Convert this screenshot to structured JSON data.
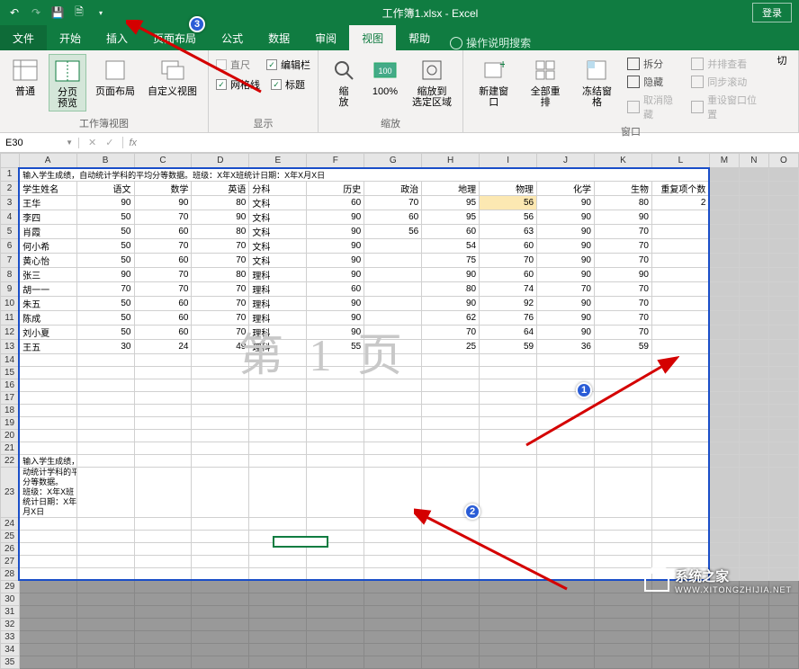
{
  "title": "工作簿1.xlsx - Excel",
  "login": "登录",
  "tabs": {
    "file": "文件",
    "home": "开始",
    "insert": "插入",
    "layout": "页面布局",
    "formula": "公式",
    "data": "数据",
    "review": "审阅",
    "view": "视图",
    "help": "帮助",
    "tellme": "操作说明搜索"
  },
  "ribbon": {
    "views": {
      "normal": "普通",
      "pagebreak": "分页\n预览",
      "pagelayout": "页面布局",
      "custom": "自定义视图",
      "group": "工作簿视图"
    },
    "show": {
      "ruler": "直尺",
      "formulabar": "编辑栏",
      "gridlines": "网格线",
      "headings": "标题",
      "group": "显示"
    },
    "zoom": {
      "zoom": "缩\n放",
      "p100": "100%",
      "fit": "缩放到\n选定区域",
      "group": "缩放"
    },
    "window": {
      "neww": "新建窗口",
      "arrange": "全部重排",
      "freeze": "冻结窗格",
      "split": "拆分",
      "hide": "隐藏",
      "unhide": "取消隐藏",
      "side": "并排查看",
      "sync": "同步滚动",
      "reset": "重设窗口位置",
      "switch": "切",
      "group": "窗口"
    }
  },
  "namebox": "E30",
  "watermark": "第 1 页",
  "cols": [
    "A",
    "B",
    "C",
    "D",
    "E",
    "F",
    "G",
    "H",
    "I",
    "J",
    "K",
    "L",
    "M",
    "N",
    "O"
  ],
  "row1": "输入学生成绩，自动统计学科的平均分等数据。班级：X年X班统计日期：X年X月X日",
  "hdr": {
    "name": "学生姓名",
    "yw": "语文",
    "sx": "数学",
    "yy": "英语",
    "fk": "分科",
    "ls": "历史",
    "zz": "政治",
    "dl": "地理",
    "wl": "物理",
    "hx": "化学",
    "sw": "生物",
    "cf": "重复项个数"
  },
  "students": [
    {
      "n": "王华",
      "yw": 90,
      "sx": 90,
      "yy": 80,
      "fk": "文科",
      "ls": 60,
      "zz": 70,
      "dl": 95,
      "wl": 56,
      "hx": 90,
      "sw": 80,
      "cf": 2
    },
    {
      "n": "李四",
      "yw": 50,
      "sx": 70,
      "yy": 90,
      "fk": "文科",
      "ls": 90,
      "zz": 60,
      "dl": 95,
      "wl": 56,
      "hx": 90,
      "sw": 90,
      "cf": ""
    },
    {
      "n": "肖霞",
      "yw": 50,
      "sx": 60,
      "yy": 80,
      "fk": "文科",
      "ls": 90,
      "zz": 56,
      "dl": 60,
      "wl": 63,
      "hx": 90,
      "sw": 70,
      "cf": ""
    },
    {
      "n": "何小希",
      "yw": 50,
      "sx": 70,
      "yy": 70,
      "fk": "文科",
      "ls": 90,
      "zz": "",
      "dl": 54,
      "wl": 60,
      "hx": 90,
      "sw": 70,
      "cf": ""
    },
    {
      "n": "黄心怡",
      "yw": 50,
      "sx": 60,
      "yy": 70,
      "fk": "文科",
      "ls": 90,
      "zz": "",
      "dl": 75,
      "wl": 70,
      "hx": 90,
      "sw": 70,
      "cf": ""
    },
    {
      "n": "张三",
      "yw": 90,
      "sx": 70,
      "yy": 80,
      "fk": "理科",
      "ls": 90,
      "zz": "",
      "dl": 90,
      "wl": 60,
      "hx": 90,
      "sw": 90,
      "cf": ""
    },
    {
      "n": "胡一一",
      "yw": 70,
      "sx": 70,
      "yy": 70,
      "fk": "理科",
      "ls": 60,
      "zz": "",
      "dl": 80,
      "wl": 74,
      "hx": 70,
      "sw": 70,
      "cf": ""
    },
    {
      "n": "朱五",
      "yw": 50,
      "sx": 60,
      "yy": 70,
      "fk": "理科",
      "ls": 90,
      "zz": "",
      "dl": 90,
      "wl": 92,
      "hx": 90,
      "sw": 70,
      "cf": ""
    },
    {
      "n": "陈成",
      "yw": 50,
      "sx": 60,
      "yy": 70,
      "fk": "理科",
      "ls": 90,
      "zz": "",
      "dl": 62,
      "wl": 76,
      "hx": 90,
      "sw": 70,
      "cf": ""
    },
    {
      "n": "刘小夏",
      "yw": 50,
      "sx": 60,
      "yy": 70,
      "fk": "理科",
      "ls": 90,
      "zz": "",
      "dl": 70,
      "wl": 64,
      "hx": 90,
      "sw": 70,
      "cf": ""
    },
    {
      "n": "王五",
      "yw": 30,
      "sx": 24,
      "yy": 49,
      "fk": "理科",
      "ls": 55,
      "zz": "",
      "dl": 25,
      "wl": 59,
      "hx": 36,
      "sw": 59,
      "cf": ""
    }
  ],
  "note": {
    "l1": "输入学生成绩，自",
    "l2": "动统计学科的平均",
    "l3": "分等数据。",
    "l4": "班级：X年X班",
    "l5": "统计日期：X年X",
    "l6": "月X日"
  },
  "site": {
    "name": "系统之家",
    "url": "WWW.XITONGZHIJIA.NET"
  },
  "circles": {
    "1": "1",
    "2": "2",
    "3": "3"
  }
}
